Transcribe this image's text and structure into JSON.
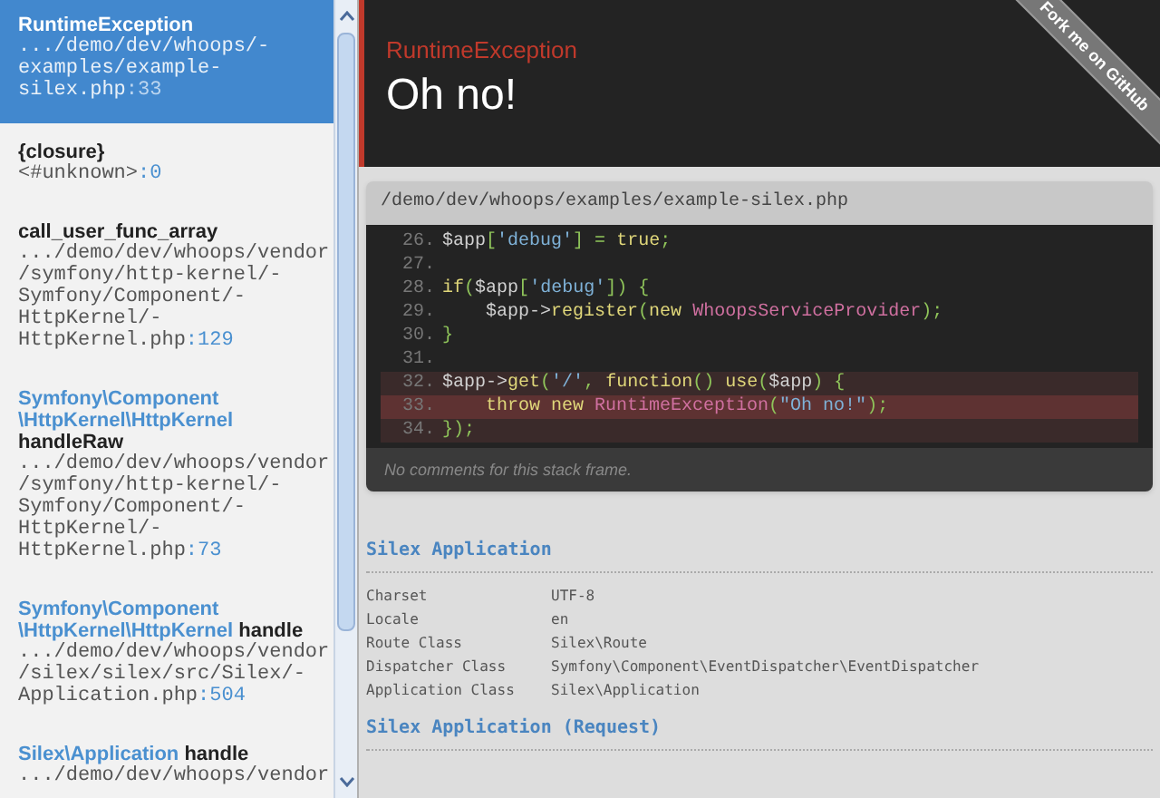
{
  "frames": [
    {
      "class_lines": [
        "RuntimeException"
      ],
      "file_lines": [
        ".../demo/dev/whoops/-",
        "examples/example-",
        "silex.php"
      ],
      "line": ":33",
      "selected": true
    },
    {
      "function": "{closure}",
      "file_lines": [
        "<#unknown>"
      ],
      "line": ":0",
      "selected": false
    },
    {
      "function": "call_user_func_array",
      "file_lines": [
        ".../demo/dev/whoops/vendor",
        "/symfony/http-kernel/-",
        "Symfony/Component/-",
        "HttpKernel/-",
        "HttpKernel.php"
      ],
      "line": ":129",
      "selected": false
    },
    {
      "class_lines": [
        "Symfony\\Component",
        "\\HttpKernel\\HttpKernel"
      ],
      "function": "handleRaw",
      "file_lines": [
        ".../demo/dev/whoops/vendor",
        "/symfony/http-kernel/-",
        "Symfony/Component/-",
        "HttpKernel/-",
        "HttpKernel.php"
      ],
      "line": ":73",
      "selected": false
    },
    {
      "class_lines": [
        "Symfony\\Component",
        "\\HttpKernel\\HttpKernel"
      ],
      "function": "handle",
      "file_lines": [
        ".../demo/dev/whoops/vendor",
        "/silex/silex/src/Silex/-",
        "Application.php"
      ],
      "line": ":504",
      "selected": false
    },
    {
      "class_lines": [
        "Silex\\Application"
      ],
      "function": "handle",
      "file_lines": [
        ".../demo/dev/whoops/vendor"
      ],
      "selected": false
    }
  ],
  "header": {
    "exception": "RuntimeException",
    "message": "Oh no!",
    "ribbon": "Fork me on GitHub"
  },
  "code_panel": {
    "file": "/demo/dev/whoops/examples/example-silex.php",
    "lines": [
      {
        "number": "26.",
        "highlighted": false,
        "current": false,
        "tokens": [
          {
            "text": "$app",
            "kind": "var"
          },
          {
            "text": "[",
            "kind": "punct"
          },
          {
            "text": "'debug'",
            "kind": "string"
          },
          {
            "text": "] = ",
            "kind": "punct"
          },
          {
            "text": "true",
            "kind": "keyword"
          },
          {
            "text": ";",
            "kind": "punct"
          }
        ]
      },
      {
        "number": "27.",
        "highlighted": false,
        "current": false
      },
      {
        "number": "28.",
        "highlighted": false,
        "current": false,
        "tokens": [
          {
            "text": "if",
            "kind": "keyword"
          },
          {
            "text": "(",
            "kind": "punct"
          },
          {
            "text": "$app",
            "kind": "var"
          },
          {
            "text": "[",
            "kind": "punct"
          },
          {
            "text": "'debug'",
            "kind": "string"
          },
          {
            "text": "]) {",
            "kind": "punct"
          }
        ]
      },
      {
        "number": "29.",
        "highlighted": false,
        "current": false,
        "tokens": [
          {
            "text": "    $app->",
            "kind": "var"
          },
          {
            "text": "register",
            "kind": "keyword"
          },
          {
            "text": "(",
            "kind": "punct"
          },
          {
            "text": "new ",
            "kind": "keyword"
          },
          {
            "text": "WhoopsServiceProvider",
            "kind": "class"
          },
          {
            "text": ");",
            "kind": "punct"
          }
        ]
      },
      {
        "number": "30.",
        "highlighted": false,
        "current": false,
        "tokens": [
          {
            "text": "}",
            "kind": "punct"
          }
        ]
      },
      {
        "number": "31.",
        "highlighted": false,
        "current": false
      },
      {
        "number": "32.",
        "highlighted": true,
        "current": false,
        "tokens": [
          {
            "text": "$app->",
            "kind": "var"
          },
          {
            "text": "get",
            "kind": "keyword"
          },
          {
            "text": "(",
            "kind": "punct"
          },
          {
            "text": "'/'",
            "kind": "string"
          },
          {
            "text": ", ",
            "kind": "punct"
          },
          {
            "text": "function",
            "kind": "keyword"
          },
          {
            "text": "() ",
            "kind": "punct"
          },
          {
            "text": "use",
            "kind": "keyword"
          },
          {
            "text": "(",
            "kind": "punct"
          },
          {
            "text": "$app",
            "kind": "var"
          },
          {
            "text": ") {",
            "kind": "punct"
          }
        ]
      },
      {
        "number": "33.",
        "highlighted": true,
        "current": true,
        "tokens": [
          {
            "text": "    throw new ",
            "kind": "keyword"
          },
          {
            "text": "RuntimeException",
            "kind": "class"
          },
          {
            "text": "(",
            "kind": "punct"
          },
          {
            "text": "\"Oh no!\"",
            "kind": "string"
          },
          {
            "text": ");",
            "kind": "punct"
          }
        ]
      },
      {
        "number": "34.",
        "highlighted": true,
        "current": false,
        "tokens": [
          {
            "text": "});",
            "kind": "punct"
          }
        ]
      }
    ],
    "comments": "No comments for this stack frame."
  },
  "sections": [
    {
      "title": "Silex Application",
      "rows": [
        {
          "key": "Charset",
          "value": "UTF-8"
        },
        {
          "key": "Locale",
          "value": "en"
        },
        {
          "key": "Route Class",
          "value": "Silex\\Route"
        },
        {
          "key": "Dispatcher Class",
          "value": "Symfony\\Component\\EventDispatcher\\EventDispatcher"
        },
        {
          "key": "Application Class",
          "value": "Silex\\Application"
        }
      ]
    },
    {
      "title": "Silex Application (Request)"
    }
  ]
}
